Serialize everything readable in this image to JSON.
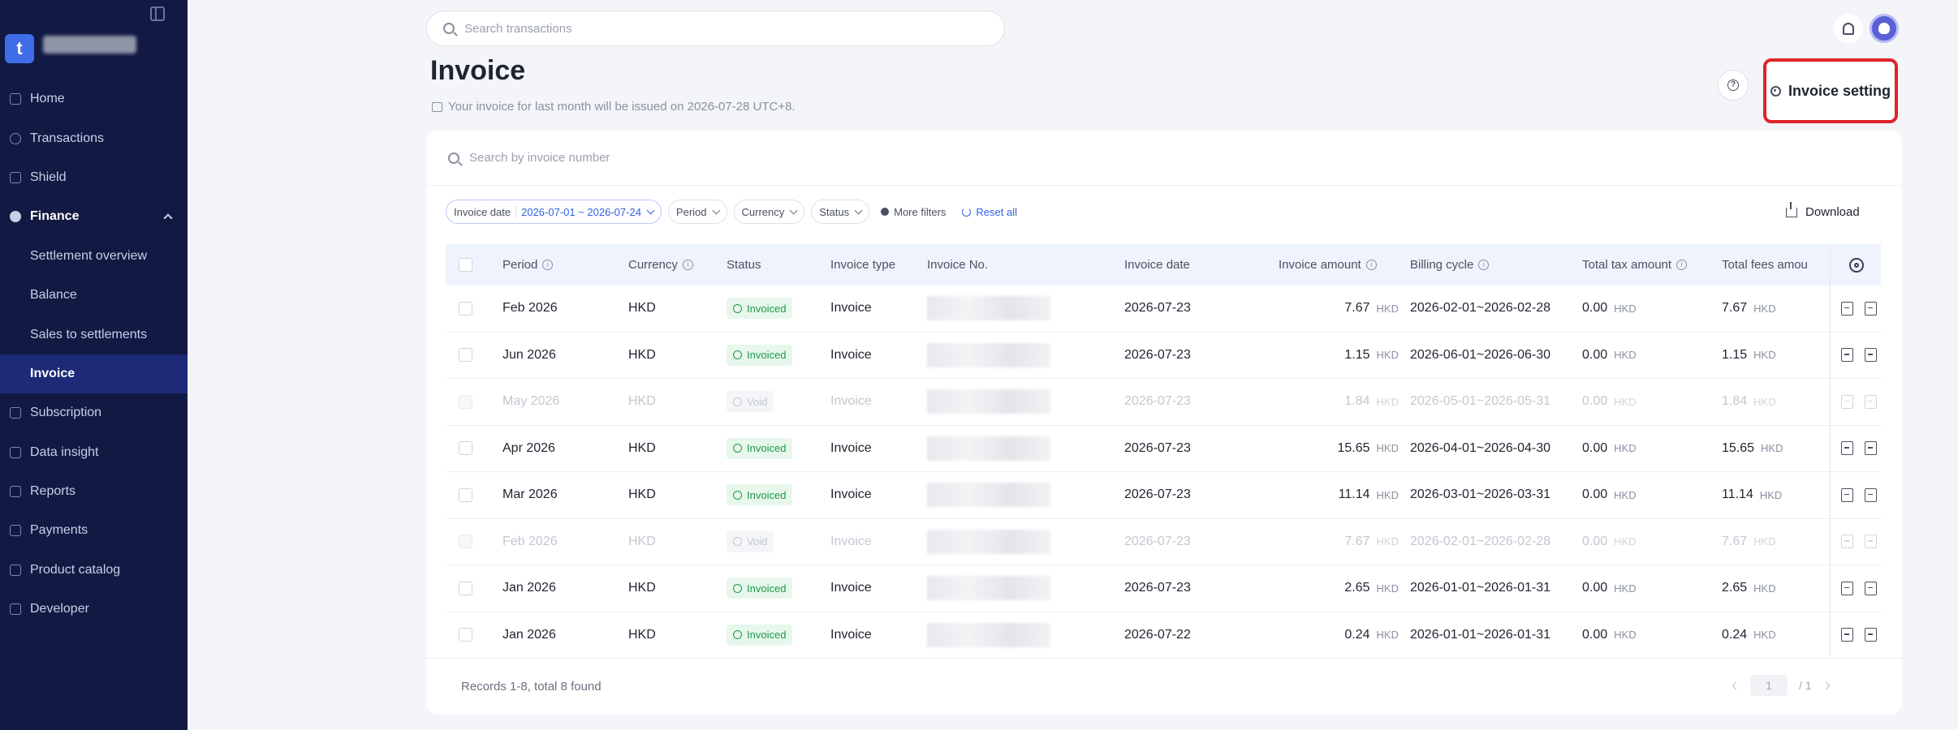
{
  "sidebar": {
    "logo_letter": "t",
    "items": [
      {
        "label": "Home",
        "icon": "home-icon"
      },
      {
        "label": "Transactions",
        "icon": "transactions-icon"
      },
      {
        "label": "Shield",
        "icon": "shield-icon"
      },
      {
        "label": "Finance",
        "icon": "finance-icon",
        "expanded": true
      },
      {
        "label": "Settlement overview"
      },
      {
        "label": "Balance"
      },
      {
        "label": "Sales to settlements"
      },
      {
        "label": "Invoice",
        "active": true
      },
      {
        "label": "Subscription",
        "icon": "subscription-icon"
      },
      {
        "label": "Data insight",
        "icon": "chart-icon"
      },
      {
        "label": "Reports",
        "icon": "reports-icon"
      },
      {
        "label": "Payments",
        "icon": "payments-icon"
      },
      {
        "label": "Product catalog",
        "icon": "catalog-icon"
      },
      {
        "label": "Developer",
        "icon": "developer-icon"
      }
    ]
  },
  "topbar": {
    "search_placeholder": "Search transactions"
  },
  "header": {
    "title": "Invoice",
    "note": "Your invoice for last month will be issued on 2026-07-28 UTC+8.",
    "setting_label": "Invoice setting"
  },
  "card": {
    "search_placeholder": "Search by invoice number",
    "filters": {
      "date_label": "Invoice date",
      "date_value": "2026-07-01 ~ 2026-07-24",
      "period": "Period",
      "currency": "Currency",
      "status": "Status",
      "more": "More filters",
      "reset": "Reset all"
    },
    "download_label": "Download"
  },
  "table": {
    "headers": {
      "period": "Period",
      "currency": "Currency",
      "status": "Status",
      "type": "Invoice type",
      "number": "Invoice No.",
      "date": "Invoice date",
      "amount": "Invoice amount",
      "cycle": "Billing cycle",
      "tax": "Total tax amount",
      "fees": "Total fees amou"
    },
    "rows": [
      {
        "period": "Feb 2026",
        "currency": "HKD",
        "status": "Invoiced",
        "type": "Invoice",
        "date": "2026-07-23",
        "amount": "7.67",
        "amount_cur": "HKD",
        "cycle": "2026-02-01~2026-02-28",
        "tax": "0.00",
        "tax_cur": "HKD",
        "fees": "7.67",
        "fees_cur": "HKD",
        "void": false
      },
      {
        "period": "Jun 2026",
        "currency": "HKD",
        "status": "Invoiced",
        "type": "Invoice",
        "date": "2026-07-23",
        "amount": "1.15",
        "amount_cur": "HKD",
        "cycle": "2026-06-01~2026-06-30",
        "tax": "0.00",
        "tax_cur": "HKD",
        "fees": "1.15",
        "fees_cur": "HKD",
        "void": false
      },
      {
        "period": "May 2026",
        "currency": "HKD",
        "status": "Void",
        "type": "Invoice",
        "date": "2026-07-23",
        "amount": "1.84",
        "amount_cur": "HKD",
        "cycle": "2026-05-01~2026-05-31",
        "tax": "0.00",
        "tax_cur": "HKD",
        "fees": "1.84",
        "fees_cur": "HKD",
        "void": true
      },
      {
        "period": "Apr 2026",
        "currency": "HKD",
        "status": "Invoiced",
        "type": "Invoice",
        "date": "2026-07-23",
        "amount": "15.65",
        "amount_cur": "HKD",
        "cycle": "2026-04-01~2026-04-30",
        "tax": "0.00",
        "tax_cur": "HKD",
        "fees": "15.65",
        "fees_cur": "HKD",
        "void": false
      },
      {
        "period": "Mar 2026",
        "currency": "HKD",
        "status": "Invoiced",
        "type": "Invoice",
        "date": "2026-07-23",
        "amount": "11.14",
        "amount_cur": "HKD",
        "cycle": "2026-03-01~2026-03-31",
        "tax": "0.00",
        "tax_cur": "HKD",
        "fees": "11.14",
        "fees_cur": "HKD",
        "void": false
      },
      {
        "period": "Feb 2026",
        "currency": "HKD",
        "status": "Void",
        "type": "Invoice",
        "date": "2026-07-23",
        "amount": "7.67",
        "amount_cur": "HKD",
        "cycle": "2026-02-01~2026-02-28",
        "tax": "0.00",
        "tax_cur": "HKD",
        "fees": "7.67",
        "fees_cur": "HKD",
        "void": true
      },
      {
        "period": "Jan 2026",
        "currency": "HKD",
        "status": "Invoiced",
        "type": "Invoice",
        "date": "2026-07-23",
        "amount": "2.65",
        "amount_cur": "HKD",
        "cycle": "2026-01-01~2026-01-31",
        "tax": "0.00",
        "tax_cur": "HKD",
        "fees": "2.65",
        "fees_cur": "HKD",
        "void": false
      },
      {
        "period": "Jan 2026",
        "currency": "HKD",
        "status": "Invoiced",
        "type": "Invoice",
        "date": "2026-07-22",
        "amount": "0.24",
        "amount_cur": "HKD",
        "cycle": "2026-01-01~2026-01-31",
        "tax": "0.00",
        "tax_cur": "HKD",
        "fees": "0.24",
        "fees_cur": "HKD",
        "void": false
      }
    ]
  },
  "footer": {
    "records": "Records 1-8, total 8 found",
    "page_current": "1",
    "page_total": "/ 1"
  }
}
